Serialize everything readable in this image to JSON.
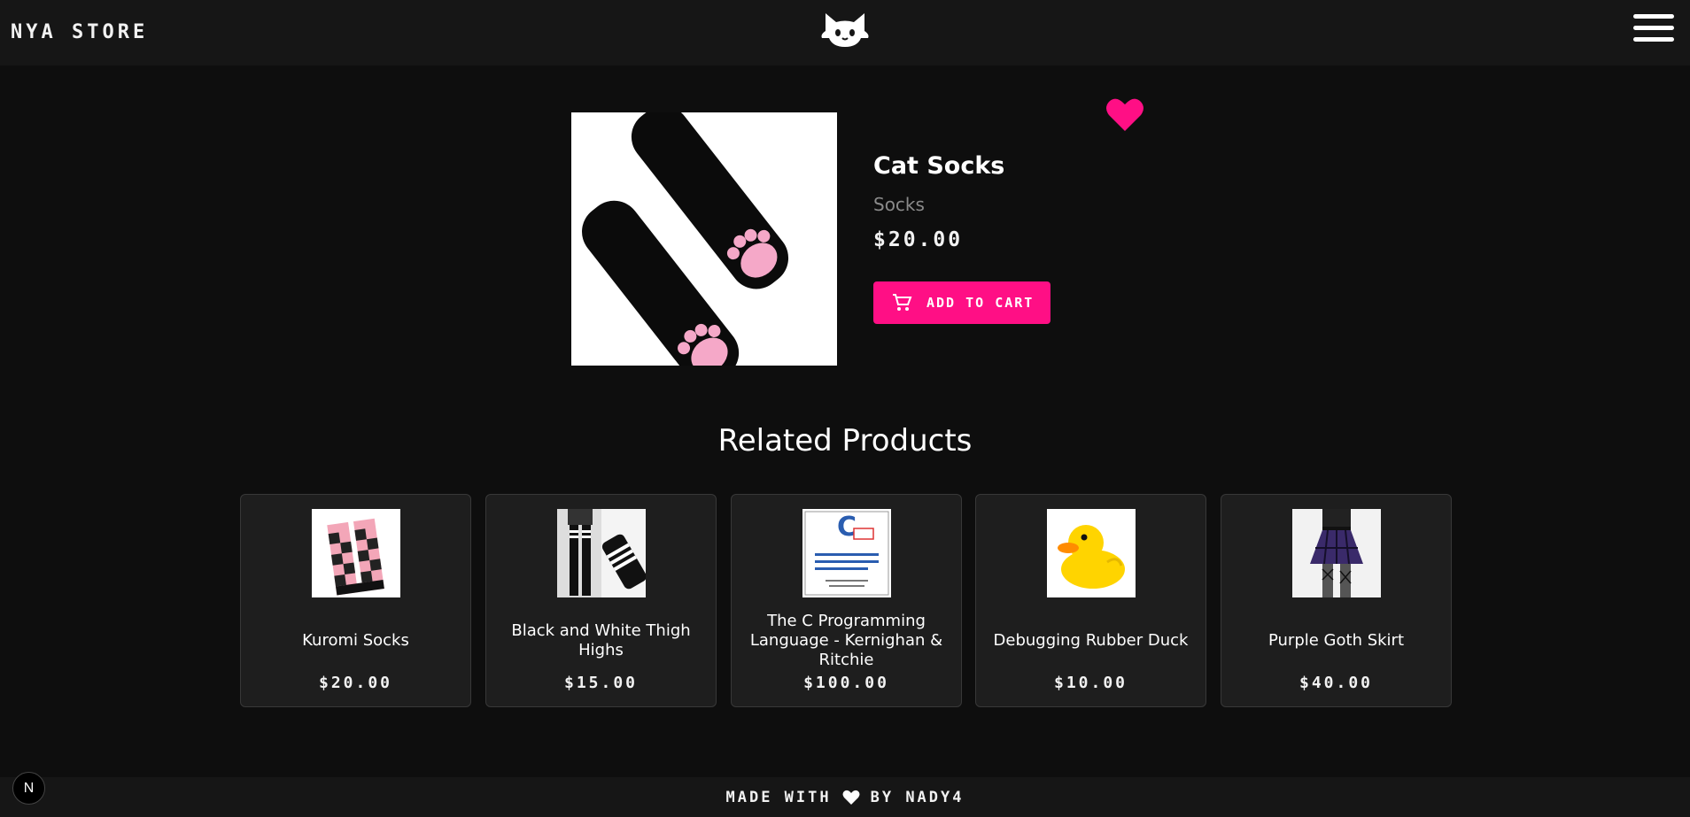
{
  "header": {
    "brand": "NYA STORE",
    "logo_icon": "cat-icon",
    "menu_icon": "hamburger-menu-icon"
  },
  "product": {
    "name": "Cat Socks",
    "category": "Socks",
    "price": "$20.00",
    "add_to_cart_label": "ADD TO CART",
    "cart_icon": "cart-icon",
    "favorite_icon": "heart-icon",
    "favorite_color": "#ff0f85"
  },
  "related": {
    "title": "Related Products",
    "items": [
      {
        "name": "Kuromi Socks",
        "price": "$20.00"
      },
      {
        "name": "Black and White Thigh Highs",
        "price": "$15.00"
      },
      {
        "name": "The C Programming Language - Kernighan & Ritchie",
        "price": "$100.00"
      },
      {
        "name": "Debugging Rubber Duck",
        "price": "$10.00"
      },
      {
        "name": "Purple Goth Skirt",
        "price": "$40.00"
      }
    ]
  },
  "footer": {
    "prefix": "MADE WITH",
    "suffix": "BY NADY4",
    "heart_icon": "heart-icon"
  },
  "dev_badge": "N",
  "colors": {
    "accent": "#ff0f85",
    "background": "#0e0e0e",
    "header": "#161616",
    "card": "#1e1e1e"
  }
}
